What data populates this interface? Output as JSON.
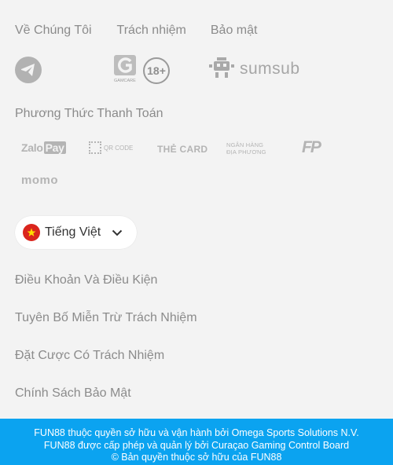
{
  "top_links": {
    "about": "Về Chúng Tôi",
    "responsibility": "Trách nhiệm",
    "security": "Bảo mật"
  },
  "badges": {
    "gamcare_caption": "GAMCARE",
    "age": "18+",
    "sumsub": "sumsub"
  },
  "payment": {
    "title": "Phương Thức Thanh Toán",
    "zalo_a": "Zalo",
    "zalo_b": "Pay",
    "qr": "QR CODE",
    "card": "THẺ CARD",
    "bank_line1": "NGÂN HÀNG",
    "bank_line2": "ĐỊA PHƯƠNG",
    "fp": "FP",
    "momo": "momo"
  },
  "language": {
    "label": "Tiếng Việt"
  },
  "menu": {
    "terms": "Điều Khoản Và Điều Kiện",
    "disclaimer": "Tuyên Bố Miễn Trừ Trách Nhiệm",
    "responsible_betting": "Đặt Cược Có Trách Nhiệm",
    "privacy": "Chính Sách Bảo Mật"
  },
  "footer": {
    "line1": "FUN88 thuộc quyền sở hữu và vận hành bởi Omega Sports Solutions N.V.",
    "line2": "FUN88 được cấp phép và quản lý bởi Curaçao Gaming Control Board",
    "line3": "© Bản quyền thuộc sở hữu của FUN88"
  },
  "colors": {
    "background": "#f3f3f3",
    "footer": "#0ba3f0",
    "muted_text": "#8b8b8b",
    "flag_red": "#da251d",
    "flag_star": "#ffdd00"
  }
}
